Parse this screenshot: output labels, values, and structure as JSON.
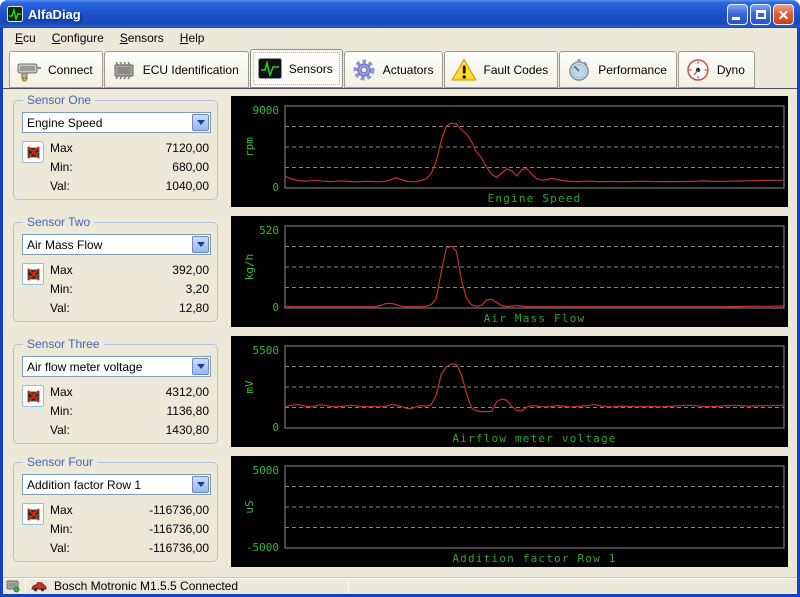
{
  "window": {
    "title": "AlfaDiag"
  },
  "menu": {
    "items": [
      {
        "prefix": "E",
        "rest": "cu"
      },
      {
        "prefix": "C",
        "rest": "onfigure"
      },
      {
        "prefix": "S",
        "rest": "ensors"
      },
      {
        "prefix": "H",
        "rest": "elp"
      }
    ]
  },
  "toolbar": {
    "buttons": [
      {
        "label": "Connect"
      },
      {
        "label": "ECU Identification"
      },
      {
        "label": "Sensors",
        "active": true
      },
      {
        "label": "Actuators"
      },
      {
        "label": "Fault Codes"
      },
      {
        "label": "Performance"
      },
      {
        "label": "Dyno"
      }
    ]
  },
  "sensors": [
    {
      "caption": "Sensor One",
      "selected": "Engine Speed",
      "stats": [
        {
          "label": "Max",
          "value": "7120,00"
        },
        {
          "label": "Min:",
          "value": "680,00"
        },
        {
          "label": "Val:",
          "value": "1040,00"
        }
      ]
    },
    {
      "caption": "Sensor Two",
      "selected": "Air Mass Flow",
      "stats": [
        {
          "label": "Max",
          "value": "392,00"
        },
        {
          "label": "Min:",
          "value": "3,20"
        },
        {
          "label": "Val:",
          "value": "12,80"
        }
      ]
    },
    {
      "caption": "Sensor Three",
      "selected": "Air flow meter voltage",
      "stats": [
        {
          "label": "Max",
          "value": "4312,00"
        },
        {
          "label": "Min:",
          "value": "1136,80"
        },
        {
          "label": "Val:",
          "value": "1430,80"
        }
      ]
    },
    {
      "caption": "Sensor Four",
      "selected": "Addition factor Row 1",
      "stats": [
        {
          "label": "Max",
          "value": "-116736,00"
        },
        {
          "label": "Min:",
          "value": "-116736,00"
        },
        {
          "label": "Val:",
          "value": "-116736,00"
        }
      ]
    }
  ],
  "statusbar": {
    "text": "Bosch Motronic M1.5.5 Connected"
  },
  "colors": {
    "trace": "#C03232",
    "grid": "#848484",
    "plot_border": "#8C8C8C",
    "tick_green": "#3CB43C",
    "title_green": "#2FA52F",
    "chart_bg": "#000000",
    "titlebar_blue": "#1E54CE",
    "desktop_beige": "#ECE9D8"
  },
  "chart_data": [
    {
      "type": "line",
      "title": "Engine Speed",
      "unit": "rpm",
      "ylim": [
        0,
        9000
      ],
      "ytick_top": "9000",
      "ytick_bottom": "0",
      "grid": "dashed",
      "legend": "none",
      "values": [
        1300,
        1050,
        880,
        800,
        760,
        800,
        850,
        790,
        730,
        700,
        740,
        790,
        760,
        710,
        680,
        700,
        730,
        710,
        690,
        700,
        730,
        900,
        1120,
        950,
        760,
        690,
        700,
        820,
        1000,
        1600,
        2900,
        5200,
        6800,
        7120,
        7050,
        6400,
        5950,
        5100,
        3950,
        3300,
        2300,
        1500,
        1150,
        1650,
        2100,
        1900,
        1320,
        2050,
        2100,
        1500,
        1000,
        860,
        920,
        1050,
        930,
        820,
        760,
        720,
        700,
        720,
        760,
        730,
        700,
        690,
        700,
        720,
        700,
        690,
        700,
        710,
        730,
        750,
        730,
        700,
        690,
        700,
        710,
        700,
        690,
        700,
        720,
        740,
        760,
        780,
        760,
        740,
        730,
        740,
        750,
        760,
        770,
        780,
        790,
        800,
        810,
        820,
        830,
        840,
        850,
        860
      ]
    },
    {
      "type": "line",
      "title": "Air Mass Flow",
      "unit": "kg/h",
      "ylim": [
        0,
        520
      ],
      "ytick_top": "520",
      "ytick_bottom": "0",
      "grid": "dashed",
      "legend": "none",
      "values": [
        10,
        9,
        8,
        8,
        8,
        8,
        8,
        8,
        8,
        8,
        8,
        8,
        8,
        8,
        8,
        8,
        8,
        8,
        9,
        16,
        28,
        30,
        22,
        12,
        8,
        8,
        8,
        9,
        11,
        20,
        60,
        230,
        380,
        392,
        360,
        180,
        60,
        20,
        10,
        18,
        50,
        55,
        35,
        14,
        9,
        12,
        16,
        12,
        9,
        8,
        8,
        8,
        8,
        8,
        8,
        8,
        8,
        8,
        8,
        8,
        8,
        8,
        8,
        8,
        8,
        8,
        8,
        8,
        8,
        8,
        8,
        8,
        8,
        8,
        8,
        8,
        8,
        8,
        8,
        8,
        8,
        8,
        8,
        8,
        8,
        8,
        8,
        8,
        9,
        9,
        9,
        10,
        10,
        10,
        11,
        11,
        11,
        12,
        12,
        12
      ]
    },
    {
      "type": "line",
      "title": "Airflow meter voltage",
      "unit": "mV",
      "ylim": [
        0,
        5500
      ],
      "ytick_top": "5500",
      "ytick_bottom": "0",
      "grid": "dashed",
      "legend": "none",
      "values": [
        1450,
        1500,
        1560,
        1540,
        1470,
        1430,
        1480,
        1560,
        1520,
        1450,
        1420,
        1440,
        1480,
        1520,
        1490,
        1440,
        1420,
        1450,
        1430,
        1420,
        1470,
        1560,
        1540,
        1450,
        1330,
        1300,
        1420,
        1500,
        1460,
        1560,
        2200,
        3600,
        4100,
        4312,
        4250,
        3600,
        2300,
        1350,
        1150,
        1100,
        1100,
        1120,
        1750,
        1950,
        1850,
        1450,
        1180,
        1150,
        1400,
        1500,
        1470,
        1430,
        1420,
        1450,
        1500,
        1470,
        1430,
        1420,
        1440,
        1470,
        1500,
        1560,
        1530,
        1470,
        1430,
        1420,
        1440,
        1470,
        1450,
        1430,
        1420,
        1440,
        1460,
        1440,
        1420,
        1430,
        1450,
        1470,
        1490,
        1510,
        1530,
        1510,
        1480,
        1450,
        1430,
        1440,
        1460,
        1480,
        1500,
        1520,
        1500,
        1480,
        1460,
        1470,
        1480,
        1490,
        1500,
        1510,
        1520,
        1530
      ]
    },
    {
      "type": "line",
      "title": "Addition factor Row 1",
      "unit": "uS",
      "ylim": [
        -5000,
        5000
      ],
      "ytick_top": "5000",
      "ytick_bottom": "-5000",
      "grid": "dashed",
      "legend": "none",
      "values": [
        -116736,
        -116736
      ]
    }
  ]
}
